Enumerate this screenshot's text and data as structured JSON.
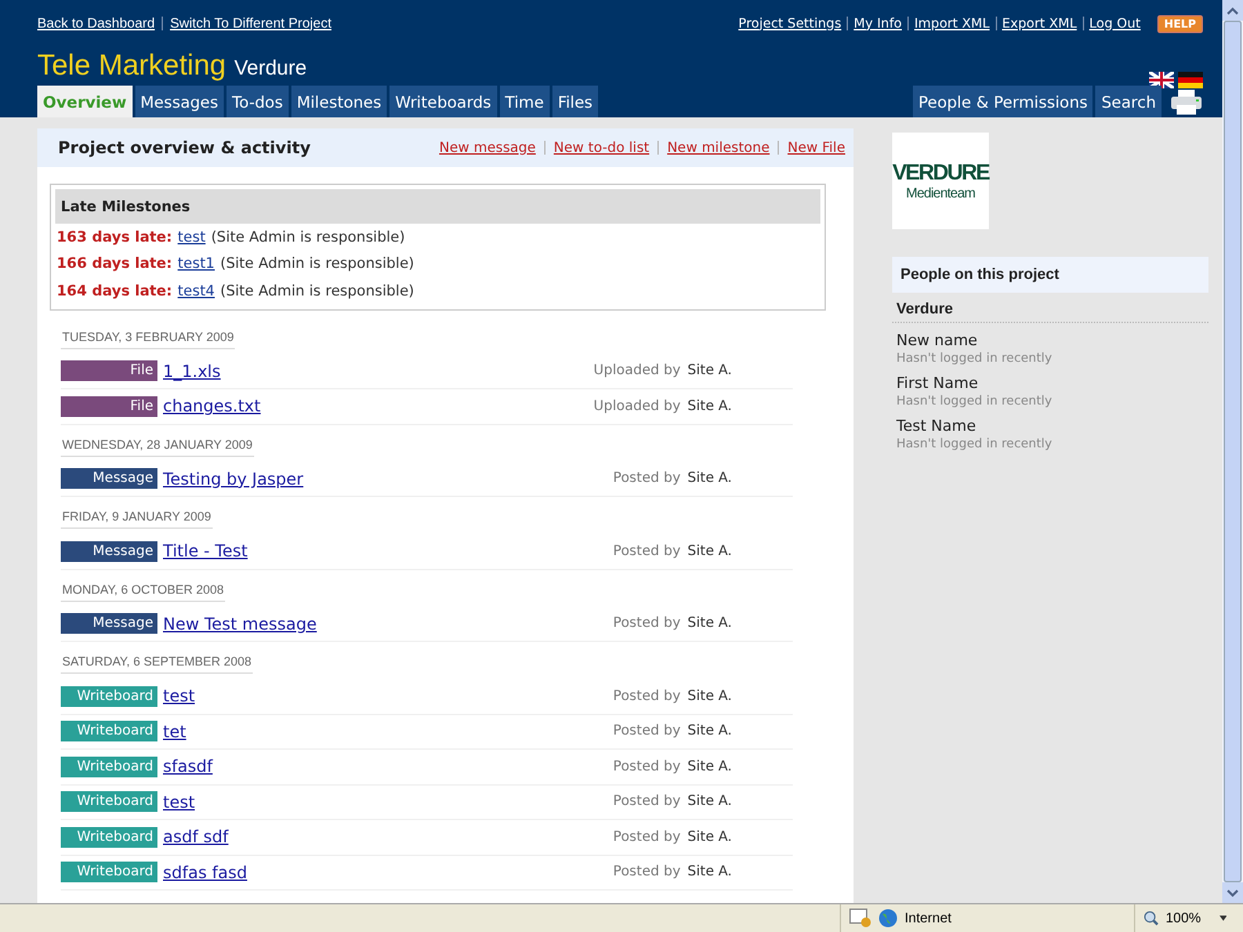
{
  "top_links": [
    "Back to Dashboard",
    "Switch To Different Project"
  ],
  "account_links": [
    "Project Settings",
    "My Info",
    "Import XML",
    "Export XML",
    "Log Out"
  ],
  "help": "HELP",
  "project": {
    "title": "Tele Marketing",
    "company": "Verdure"
  },
  "tabs": [
    {
      "label": "Overview",
      "selected": true
    },
    {
      "label": "Messages",
      "selected": false
    },
    {
      "label": "To-dos",
      "selected": false
    },
    {
      "label": "Milestones",
      "selected": false
    },
    {
      "label": "Writeboards",
      "selected": false
    },
    {
      "label": "Time",
      "selected": false
    },
    {
      "label": "Files",
      "selected": false
    }
  ],
  "right_tabs": [
    {
      "label": "People & Permissions",
      "selected": false
    },
    {
      "label": "Search",
      "selected": false
    }
  ],
  "panel": {
    "title": "Project overview & activity",
    "actions": [
      "New message",
      "New to-do list",
      "New milestone",
      "New File"
    ]
  },
  "late_milestones": {
    "title": "Late Milestones",
    "items": [
      {
        "late": "163 days late:",
        "name": "test",
        "note": "(Site Admin is responsible)"
      },
      {
        "late": "166 days late:",
        "name": "test1",
        "note": "(Site Admin is responsible)"
      },
      {
        "late": "164 days late:",
        "name": "test4",
        "note": "(Site Admin is responsible)"
      }
    ]
  },
  "activity": [
    {
      "date": "TUESDAY, 3 FEBRUARY 2009",
      "items": [
        {
          "kind": "file",
          "badge": "File",
          "title": "1_1.xls",
          "by": "Uploaded by",
          "author": "Site A."
        },
        {
          "kind": "file",
          "badge": "File",
          "title": "changes.txt",
          "by": "Uploaded by",
          "author": "Site A."
        }
      ]
    },
    {
      "date": "WEDNESDAY, 28 JANUARY 2009",
      "items": [
        {
          "kind": "message",
          "badge": "Message",
          "title": "Testing by Jasper",
          "by": "Posted by",
          "author": "Site A."
        }
      ]
    },
    {
      "date": "FRIDAY, 9 JANUARY 2009",
      "items": [
        {
          "kind": "message",
          "badge": "Message",
          "title": "Title - Test",
          "by": "Posted by",
          "author": "Site A."
        }
      ]
    },
    {
      "date": "MONDAY, 6 OCTOBER 2008",
      "items": [
        {
          "kind": "message",
          "badge": "Message",
          "title": "New Test message",
          "by": "Posted by",
          "author": "Site A."
        }
      ]
    },
    {
      "date": "SATURDAY, 6 SEPTEMBER 2008",
      "items": [
        {
          "kind": "writeboard",
          "badge": "Writeboard",
          "title": "test",
          "by": "Posted by",
          "author": "Site A."
        },
        {
          "kind": "writeboard",
          "badge": "Writeboard",
          "title": "tet",
          "by": "Posted by",
          "author": "Site A."
        },
        {
          "kind": "writeboard",
          "badge": "Writeboard",
          "title": "sfasdf",
          "by": "Posted by",
          "author": "Site A."
        },
        {
          "kind": "writeboard",
          "badge": "Writeboard",
          "title": "test",
          "by": "Posted by",
          "author": "Site A."
        },
        {
          "kind": "writeboard",
          "badge": "Writeboard",
          "title": "asdf sdf",
          "by": "Posted by",
          "author": "Site A."
        },
        {
          "kind": "writeboard",
          "badge": "Writeboard",
          "title": "sdfas fasd",
          "by": "Posted by",
          "author": "Site A."
        }
      ]
    }
  ],
  "logo": {
    "name": "VERDURE",
    "tagline": "Medienteam"
  },
  "people": {
    "title": "People on this project",
    "company": "Verdure",
    "members": [
      {
        "name": "New name",
        "status": "Hasn't logged in recently"
      },
      {
        "name": "First Name",
        "status": "Hasn't logged in recently"
      },
      {
        "name": "Test Name",
        "status": "Hasn't logged in recently"
      }
    ]
  },
  "status_bar": {
    "zone": "Internet",
    "zoom": "100%"
  }
}
